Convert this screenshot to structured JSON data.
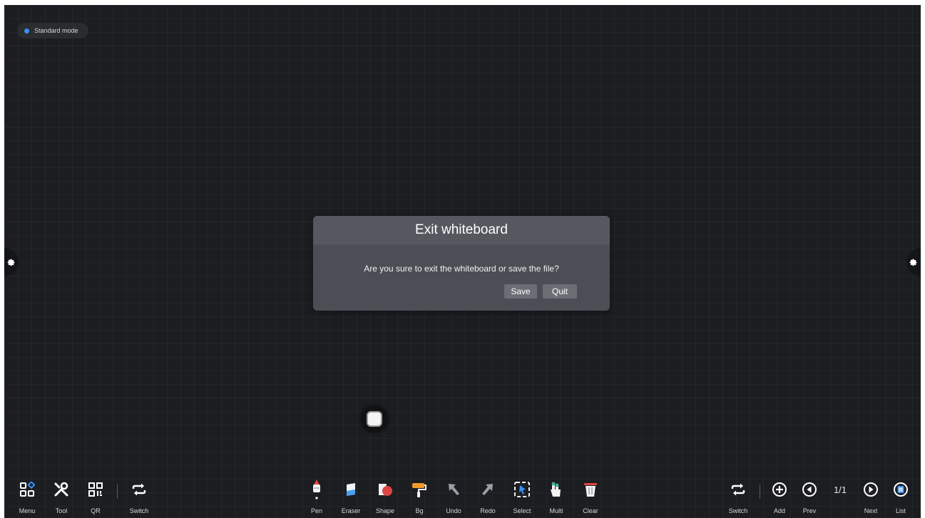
{
  "status": {
    "mode_label": "Standard mode",
    "dot_color": "#3b8ff5"
  },
  "dialog": {
    "title": "Exit whiteboard",
    "message": "Are you sure to exit the whiteboard or save the file?",
    "save_label": "Save",
    "quit_label": "Quit"
  },
  "toolbar_left": {
    "menu": "Menu",
    "tool": "Tool",
    "qr": "QR",
    "switch": "Switch"
  },
  "toolbar_center": {
    "pen": "Pen",
    "eraser": "Eraser",
    "shape": "Shape",
    "bg": "Bg",
    "undo": "Undo",
    "redo": "Redo",
    "select": "Select",
    "multi": "Multi",
    "clear": "Clear"
  },
  "toolbar_right": {
    "switch": "Switch",
    "add": "Add",
    "prev": "Prev",
    "page_indicator": "1/1",
    "next": "Next",
    "list": "List"
  },
  "icons": {
    "menu": "menu-grid-icon",
    "tool": "tools-icon",
    "qr": "qr-code-icon",
    "switch": "switch-arrows-icon",
    "pen": "pen-icon",
    "eraser": "eraser-icon",
    "shape": "shape-icon",
    "bg": "paint-roller-icon",
    "undo": "undo-arrow-icon",
    "redo": "redo-arrow-icon",
    "select": "select-icon",
    "multi": "multi-touch-icon",
    "clear": "trash-icon",
    "add": "plus-circle-icon",
    "prev": "prev-circle-icon",
    "next": "next-circle-icon",
    "list": "list-circle-icon",
    "gear": "gear-icon"
  },
  "colors": {
    "board_bg": "#1c1d20",
    "accent_blue": "#3b8ff5",
    "bg_tool": "#f39a2a",
    "shape_red": "#e04545"
  }
}
